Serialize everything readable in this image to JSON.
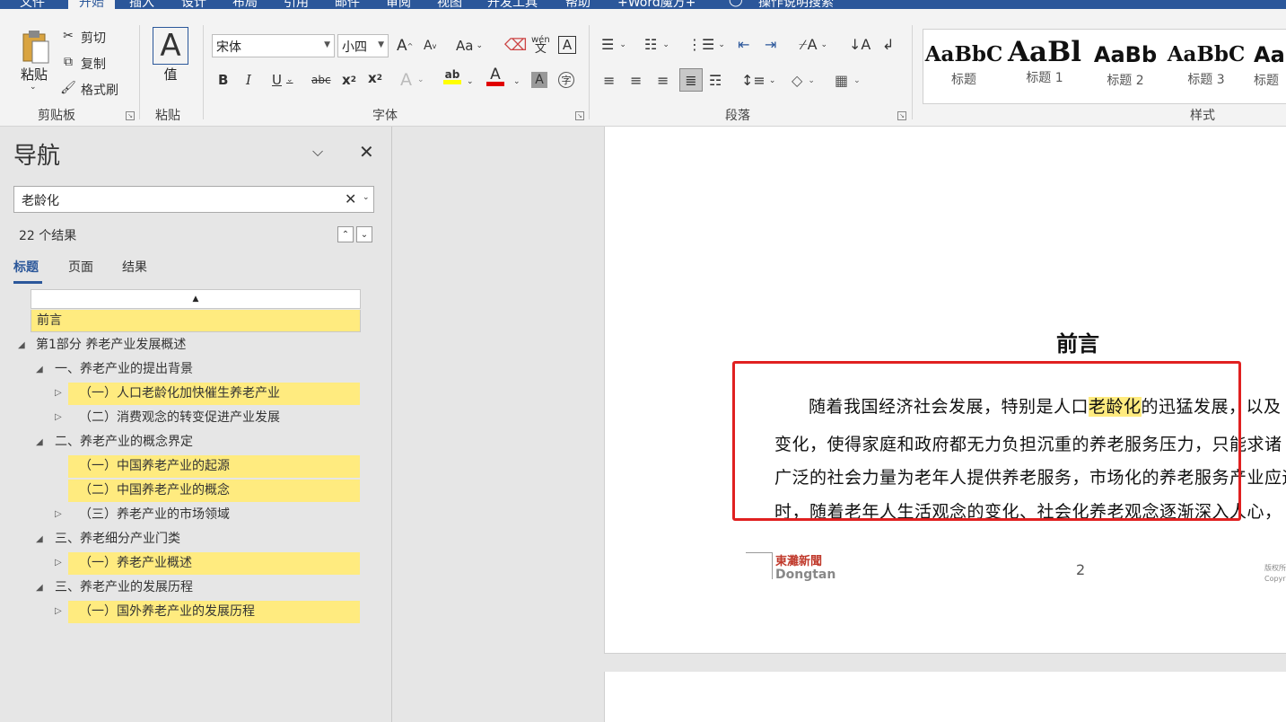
{
  "ribbon_tabs": [
    "文件",
    "开始",
    "插入",
    "设计",
    "布局",
    "引用",
    "邮件",
    "审阅",
    "视图",
    "开发工具",
    "帮助",
    "+Word魔方+"
  ],
  "tell_me": "操作说明搜索",
  "clipboard": {
    "paste": "粘贴",
    "cut": "剪切",
    "copy": "复制",
    "format_painter": "格式刷",
    "label": "剪贴板"
  },
  "paste_group": {
    "value": "值",
    "label": "粘贴"
  },
  "font": {
    "name": "宋体",
    "size": "小四",
    "label": "字体",
    "case_btn": "Aa",
    "grow": "A",
    "shrink": "A",
    "bold": "B",
    "italic": "I",
    "underline": "U",
    "strike": "abc",
    "sub": "x",
    "sup": "x",
    "wen": "wén",
    "wen_char": "文",
    "highlight_color": "#ffff00",
    "font_color": "#e00000"
  },
  "paragraph": {
    "label": "段落"
  },
  "styles": {
    "label": "样式",
    "items": [
      {
        "preview": "AaBbC",
        "name": "标题"
      },
      {
        "preview": "AaBl",
        "name": "标题 1"
      },
      {
        "preview": "AaBb",
        "name": "标题 2"
      },
      {
        "preview": "AaBbC",
        "name": "标题 3"
      },
      {
        "preview": "AaBb",
        "name": "标题"
      }
    ]
  },
  "nav": {
    "title": "导航",
    "search": "老龄化",
    "results": "22 个结果",
    "tabs": [
      "标题",
      "页面",
      "结果"
    ],
    "tree": [
      {
        "text": "前言",
        "level": 0,
        "hl": true,
        "tri": ""
      },
      {
        "text": "第1部分  养老产业发展概述",
        "level": 0,
        "hl": false,
        "tri": "◢"
      },
      {
        "text": "一、养老产业的提出背景",
        "level": 1,
        "hl": false,
        "tri": "◢"
      },
      {
        "text": "（一）人口老龄化加快催生养老产业",
        "level": 2,
        "hl": true,
        "tri": "▷"
      },
      {
        "text": "（二）消费观念的转变促进产业发展",
        "level": 2,
        "hl": false,
        "tri": "▷"
      },
      {
        "text": "二、养老产业的概念界定",
        "level": 1,
        "hl": false,
        "tri": "◢"
      },
      {
        "text": "（一）中国养老产业的起源",
        "level": 2,
        "hl": true,
        "tri": ""
      },
      {
        "text": "（二）中国养老产业的概念",
        "level": 2,
        "hl": true,
        "tri": ""
      },
      {
        "text": "（三）养老产业的市场领域",
        "level": 2,
        "hl": false,
        "tri": "▷"
      },
      {
        "text": "三、养老细分产业门类",
        "level": 1,
        "hl": false,
        "tri": "◢"
      },
      {
        "text": "（一）养老产业概述",
        "level": 2,
        "hl": true,
        "tri": "▷"
      },
      {
        "text": "三、养老产业的发展历程",
        "level": 1,
        "hl": false,
        "tri": "◢"
      },
      {
        "text": "（一）国外养老产业的发展历程",
        "level": 2,
        "hl": true,
        "tri": "▷"
      }
    ]
  },
  "doc": {
    "title": "前言",
    "line1_a": "随着我国经济社会发展，特别是人口",
    "line1_mark": "老龄化",
    "line1_b": "的迅猛发展，以及",
    "line2": "变化，使得家庭和政府都无力负担沉重的养老服务压力，只能求诸",
    "line3": "广泛的社会力量为老年人提供养老服务，市场化的养老服务产业应运",
    "line4": "时，随着老年人生活观念的变化、社会化养老观念逐渐深入人心，",
    "page_number": "2",
    "logo_cn": "東灘新聞",
    "logo_en": "Dongtan",
    "copyright_1": "版权所",
    "copyright_2": "Copyri"
  }
}
